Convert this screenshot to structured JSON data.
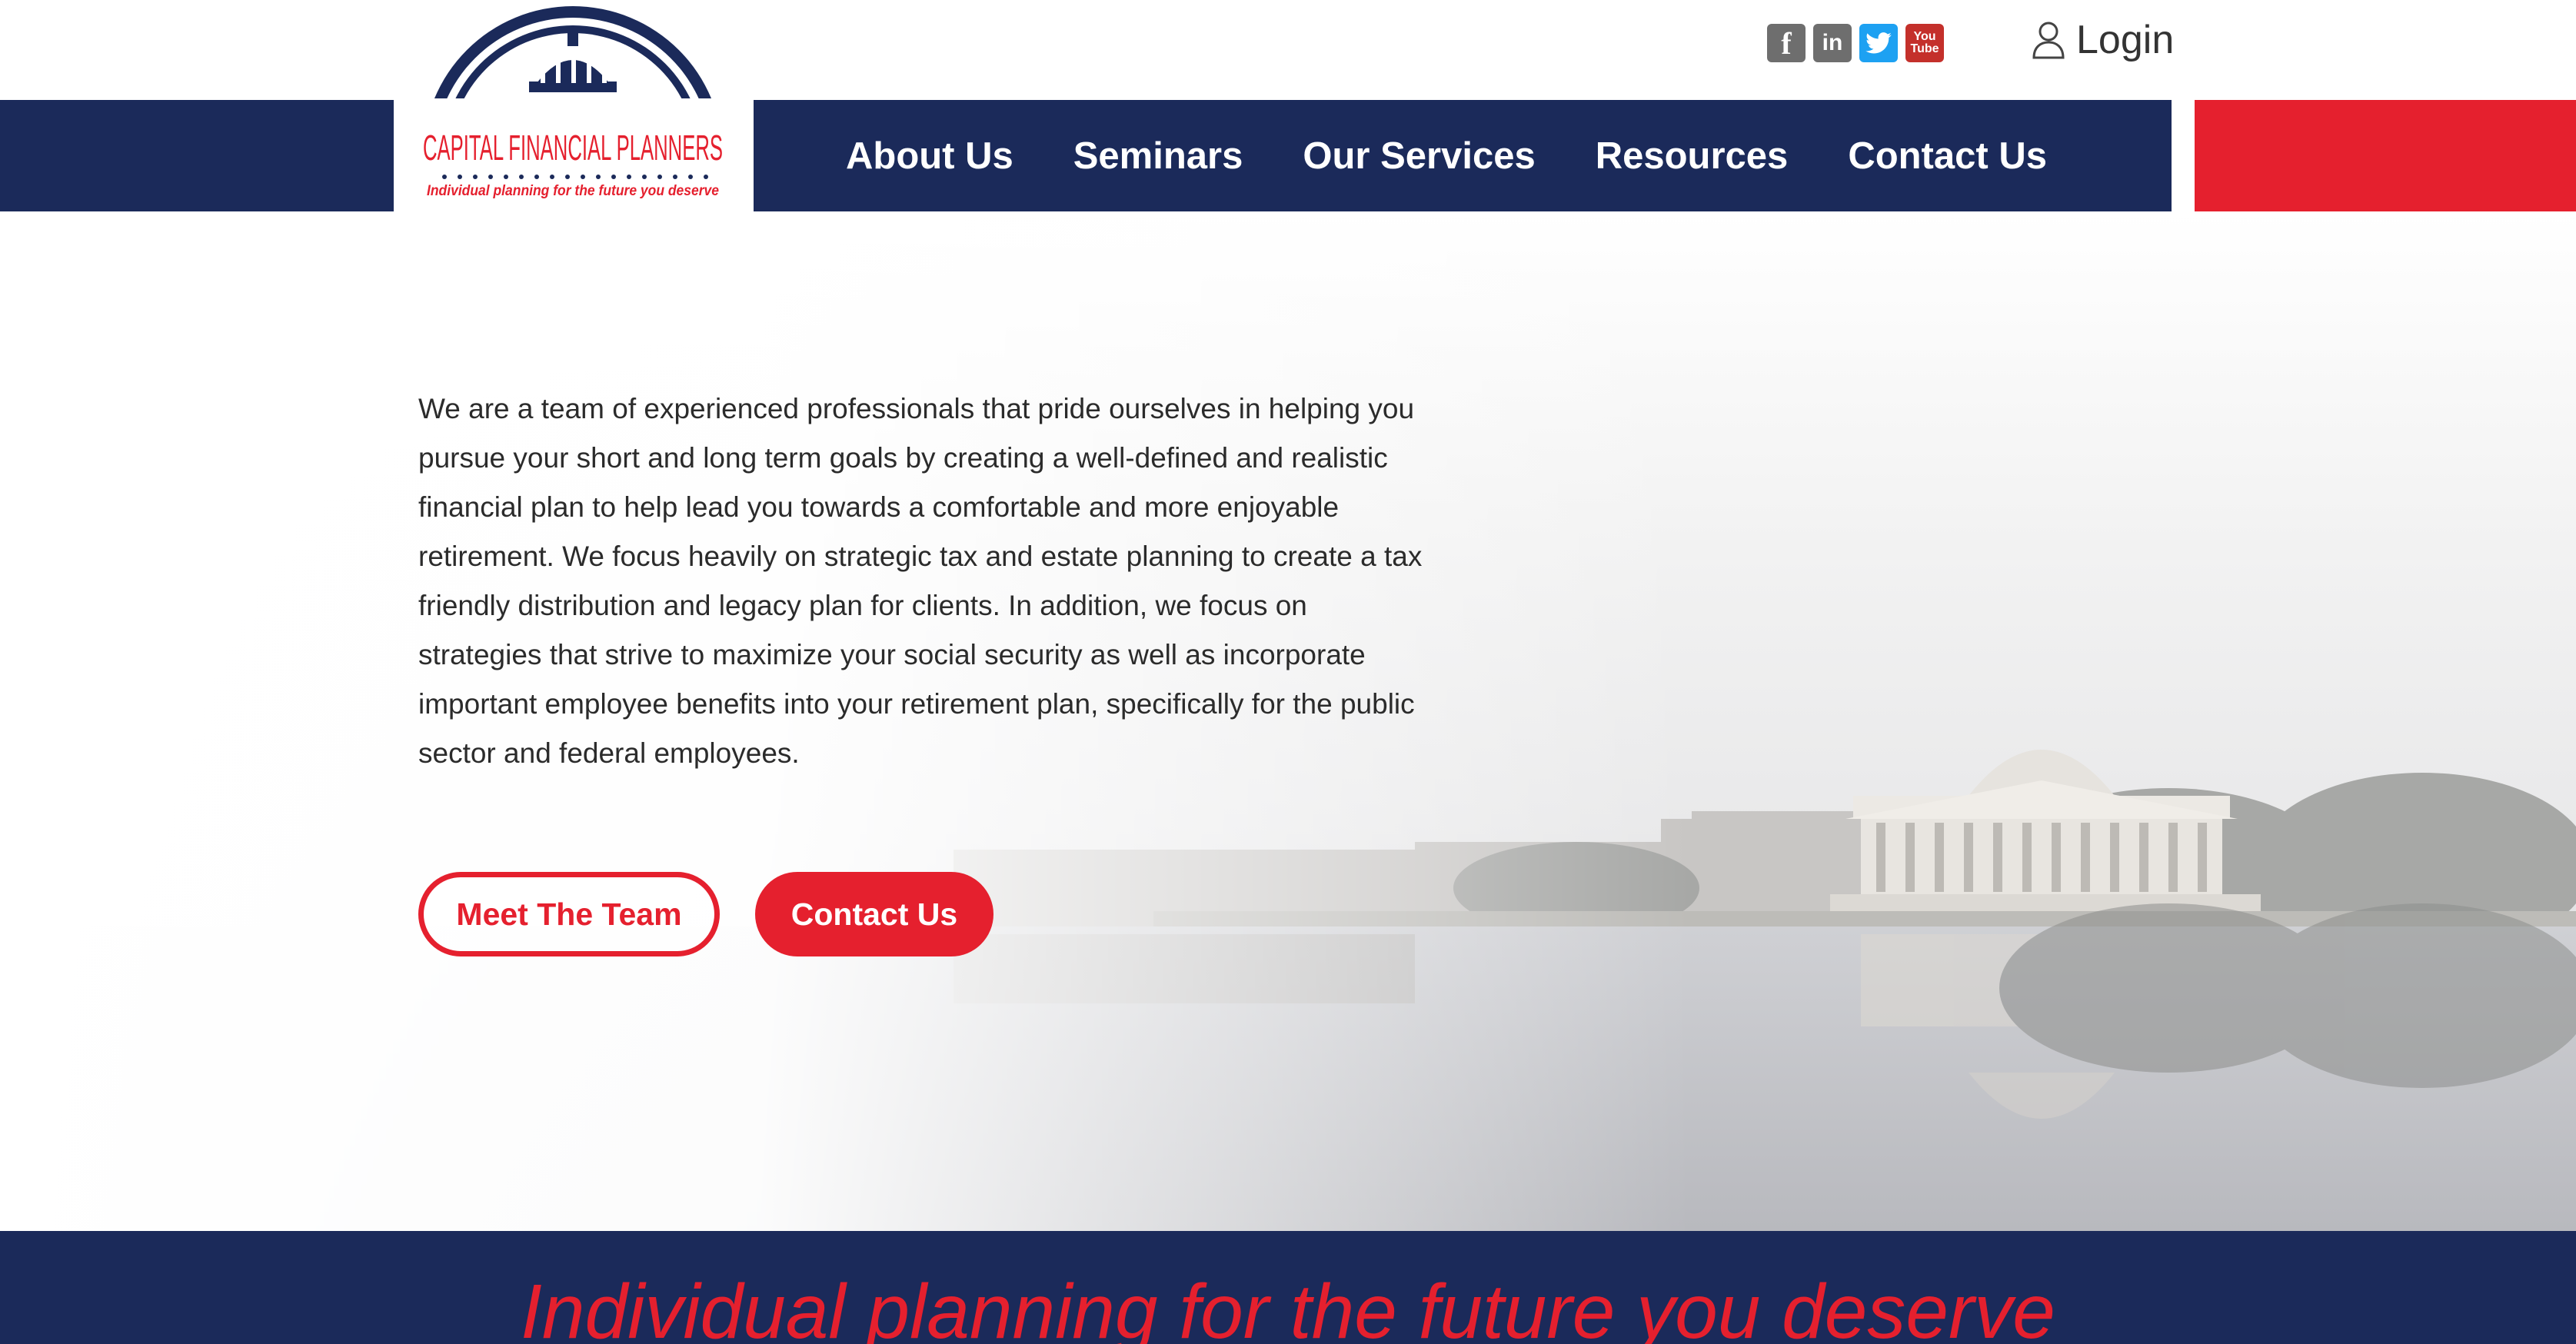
{
  "header": {
    "social": [
      {
        "name": "facebook-icon",
        "glyph": "f"
      },
      {
        "name": "linkedin-icon",
        "glyph": "in"
      },
      {
        "name": "twitter-icon",
        "glyph": ""
      },
      {
        "name": "youtube-icon",
        "glyph_top": "You",
        "glyph_bottom": "Tube"
      }
    ],
    "login_label": "Login"
  },
  "logo": {
    "title": "CAPITAL FINANCIAL PLANNERS",
    "tagline": "Individual planning for the future you deserve"
  },
  "nav": {
    "items": [
      "About Us",
      "Seminars",
      "Our Services",
      "Resources",
      "Contact Us"
    ]
  },
  "hero": {
    "intro": "We are a team of experienced professionals that pride ourselves in helping you pursue your short and long term goals by creating a well-defined and realistic financial plan to help lead you towards a comfortable and more enjoyable retirement. We focus heavily on strategic tax and estate planning to create a tax friendly distribution and legacy plan for clients. In addition, we focus on strategies that strive to maximize your social security as well as incorporate important employee benefits into your retirement plan, specifically for the public sector and federal employees.",
    "buttons": {
      "meet_team": "Meet The Team",
      "contact": "Contact Us"
    }
  },
  "band": {
    "tagline": "Individual planning for the future you deserve"
  },
  "colors": {
    "navy": "#1b2a5a",
    "red": "#e5202e",
    "text": "#2b2b2b"
  }
}
